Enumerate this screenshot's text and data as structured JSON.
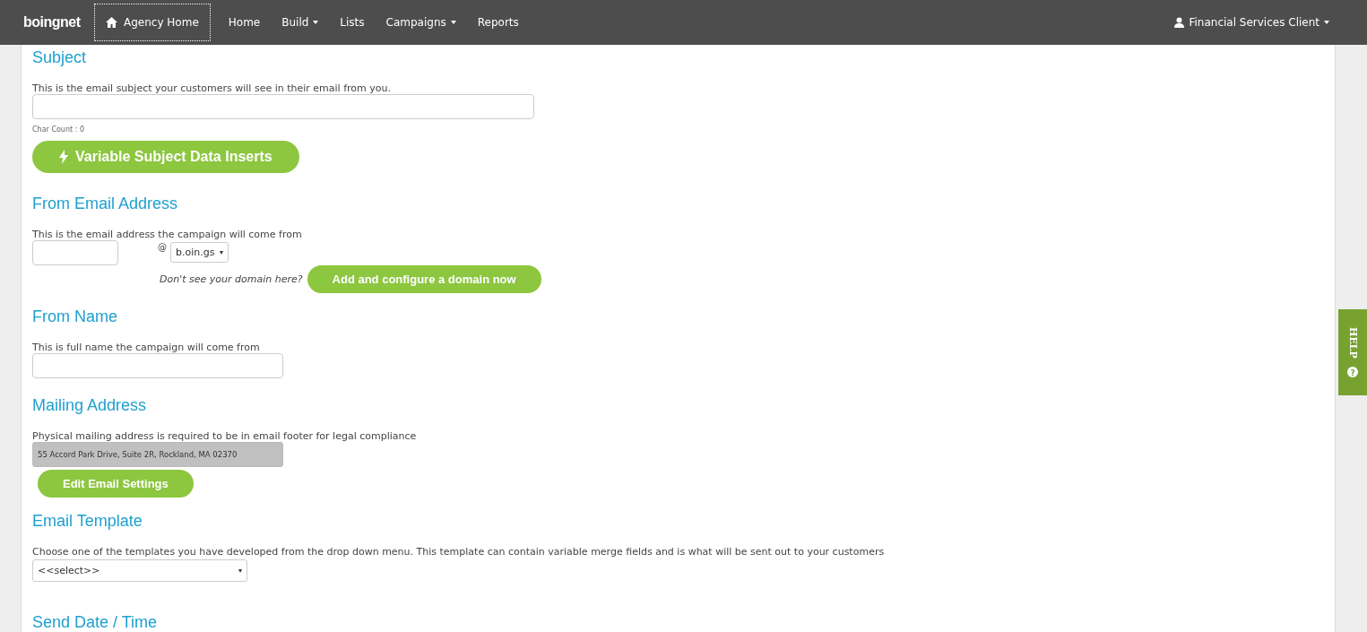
{
  "navbar": {
    "logo": "boingnet",
    "home_link": "Agency Home",
    "items": [
      {
        "label": "Home",
        "dropdown": false
      },
      {
        "label": "Build",
        "dropdown": true
      },
      {
        "label": "Lists",
        "dropdown": false
      },
      {
        "label": "Campaigns",
        "dropdown": true
      },
      {
        "label": "Reports",
        "dropdown": false
      }
    ],
    "user": "Financial Services Client"
  },
  "subject": {
    "heading": "Subject",
    "description": "This is the email subject your customers will see in their email from you.",
    "char_count": "Char Count : 0",
    "button": "Variable Subject Data Inserts"
  },
  "from_email": {
    "heading": "From Email Address",
    "description": "This is the email address the campaign will come from",
    "at": "@",
    "domain": "b.oin.gs",
    "hint": "Don't see your domain here?",
    "button": "Add and configure a domain now"
  },
  "from_name": {
    "heading": "From Name",
    "description": "This is full name the campaign will come from"
  },
  "mailing_address": {
    "heading": "Mailing Address",
    "description": "Physical mailing address is required to be in email footer for legal compliance",
    "value": "55 Accord Park Drive, Suite 2R, Rockland, MA 02370",
    "button": "Edit Email Settings"
  },
  "email_template": {
    "heading": "Email Template",
    "description": "Choose one of the templates you have developed from the drop down menu. This template can contain variable merge fields and is what will be sent out to your customers",
    "value": "<<select>>"
  },
  "send_date": {
    "heading": "Send Date / Time"
  },
  "help_tab": "HELP",
  "help_icon": "?"
}
